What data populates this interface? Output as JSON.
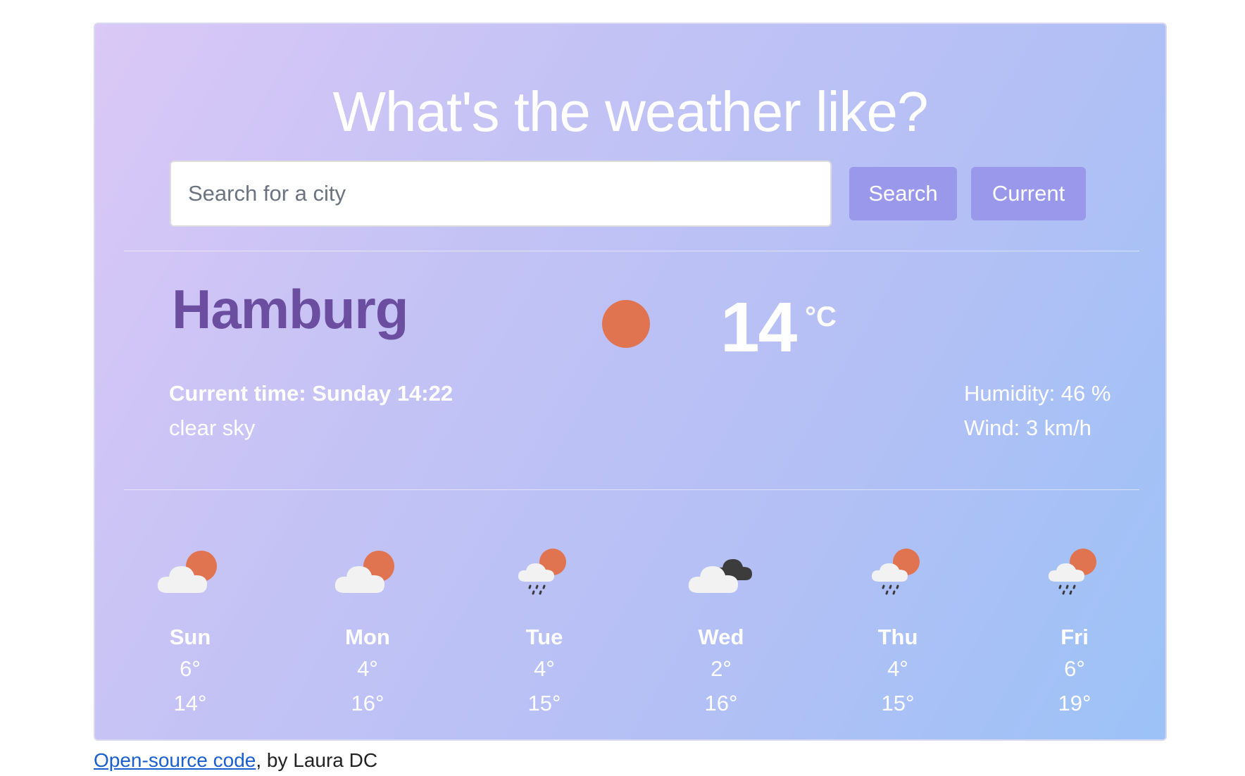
{
  "header": {
    "title": "What's the weather like?"
  },
  "search": {
    "placeholder": "Search for a city",
    "search_button": "Search",
    "current_button": "Current"
  },
  "current": {
    "city": "Hamburg",
    "icon": "sun-icon",
    "temperature": "14",
    "unit": "°C",
    "time": "Current time: Sunday 14:22",
    "description": "clear sky",
    "humidity": "Humidity: 46 %",
    "wind": "Wind: 3 km/h"
  },
  "forecast": [
    {
      "day": "Sun",
      "low": "6°",
      "high": "14°",
      "icon": "partly-cloudy-icon"
    },
    {
      "day": "Mon",
      "low": "4°",
      "high": "16°",
      "icon": "partly-cloudy-icon"
    },
    {
      "day": "Tue",
      "low": "4°",
      "high": "15°",
      "icon": "rain-sun-icon"
    },
    {
      "day": "Wed",
      "low": "2°",
      "high": "16°",
      "icon": "dark-cloudy-icon"
    },
    {
      "day": "Thu",
      "low": "4°",
      "high": "15°",
      "icon": "rain-sun-icon"
    },
    {
      "day": "Fri",
      "low": "6°",
      "high": "19°",
      "icon": "rain-sun-icon"
    }
  ],
  "footer": {
    "link_text": "Open-source code",
    "suffix": ", by Laura DC"
  },
  "colors": {
    "sun": "#e07450",
    "cloud": "#f2f2f2",
    "dark_cloud": "#3c3c3c",
    "button": "#9a98ea",
    "city_text": "#6b4ea0"
  }
}
